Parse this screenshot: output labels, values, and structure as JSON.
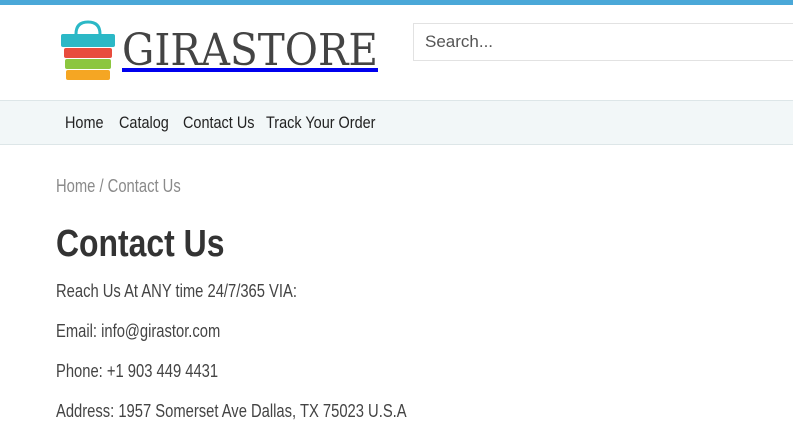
{
  "brand": {
    "name": "GIRASTORE"
  },
  "search": {
    "placeholder": "Search..."
  },
  "nav": {
    "items": [
      "Home",
      "Catalog",
      "Contact Us",
      "Track Your Order"
    ]
  },
  "breadcrumb": {
    "home": "Home",
    "separator": " / ",
    "current": "Contact Us"
  },
  "page": {
    "title": "Contact Us",
    "lines": [
      "Reach Us At ANY time 24/7/365 VIA:",
      "Email: info@girastor.com",
      "Phone: +1 903 449 4431",
      "Address: 1957 Somerset Ave Dallas, TX 75023 U.S.A"
    ]
  },
  "colors": {
    "accent": "#4aa8d8",
    "nav_bg": "#f2f7f8",
    "text": "#333333"
  },
  "icons": {
    "logo": "shopping-bag-icon"
  }
}
